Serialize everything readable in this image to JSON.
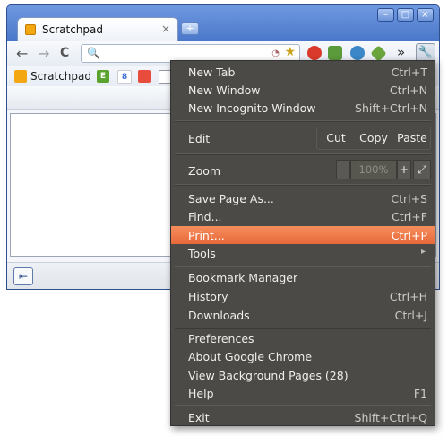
{
  "tab": {
    "title": "Scratchpad",
    "close": "×"
  },
  "window_buttons": [
    "–",
    "□",
    "×"
  ],
  "newtab_glyph": "+",
  "nav": {
    "back": "←",
    "forward": "→",
    "reload": "C"
  },
  "omnibox": {
    "search_glyph": "🔍",
    "star_glyph": "★"
  },
  "extensions": [
    {
      "name": "tomato-extension-icon",
      "color": "#d93a2b"
    },
    {
      "name": "evernote-extension-icon",
      "color": "#5c9b3c"
    },
    {
      "name": "bird-extension-icon",
      "color": "#3b87c8"
    },
    {
      "name": "green-arrow-extension-icon",
      "color": "#6aa53c"
    }
  ],
  "overflow_chevron": "»",
  "bookmarks": {
    "items": [
      {
        "label": "Scratchpad"
      },
      {
        "label": "E"
      },
      {
        "label": "8"
      },
      {
        "label": ""
      }
    ]
  },
  "pad": {
    "outdent_glyph": "⇤"
  },
  "menu": {
    "new_tab": {
      "label": "New Tab",
      "accel": "Ctrl+T"
    },
    "new_window": {
      "label": "New Window",
      "accel": "Ctrl+N"
    },
    "new_incognito": {
      "label": "New Incognito Window",
      "accel": "Shift+Ctrl+N"
    },
    "edit": {
      "label": "Edit",
      "cut": "Cut",
      "copy": "Copy",
      "paste": "Paste"
    },
    "zoom": {
      "label": "Zoom",
      "minus": "-",
      "value": "100%",
      "plus": "+"
    },
    "save_page": {
      "label": "Save Page As...",
      "accel": "Ctrl+S"
    },
    "find": {
      "label": "Find...",
      "accel": "Ctrl+F"
    },
    "print": {
      "label": "Print...",
      "accel": "Ctrl+P"
    },
    "tools": {
      "label": "Tools",
      "arrow": "▸"
    },
    "bookmark_manager": {
      "label": "Bookmark Manager"
    },
    "history": {
      "label": "History",
      "accel": "Ctrl+H"
    },
    "downloads": {
      "label": "Downloads",
      "accel": "Ctrl+J"
    },
    "preferences": {
      "label": "Preferences"
    },
    "about": {
      "label": "About Google Chrome"
    },
    "background_pages": {
      "label": "View Background Pages (28)"
    },
    "help": {
      "label": "Help",
      "accel": "F1"
    },
    "exit": {
      "label": "Exit",
      "accel": "Shift+Ctrl+Q"
    }
  },
  "colors": {
    "accent": "#ee7a48",
    "menu_bg": "#4b4a47",
    "titlebar": "#4a77c9"
  }
}
